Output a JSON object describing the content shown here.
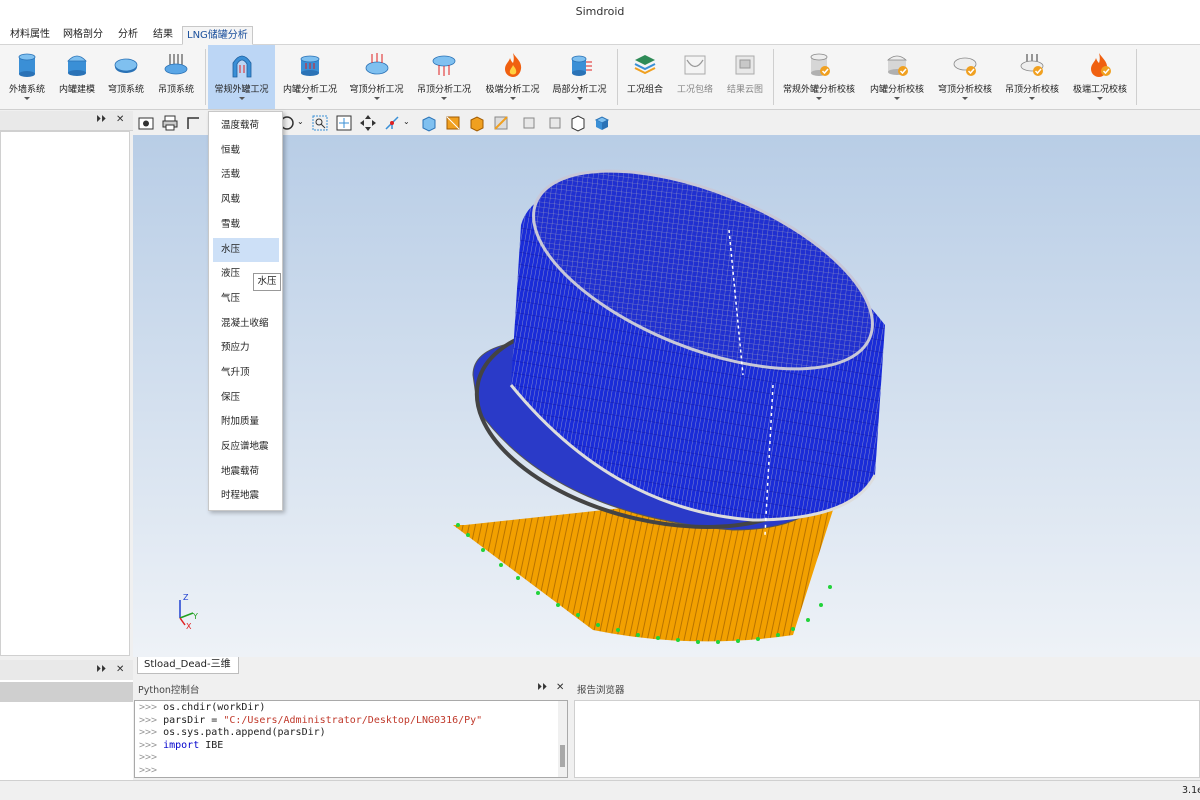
{
  "app": {
    "title": "Simdroid"
  },
  "tabs": [
    {
      "label": "材料属性"
    },
    {
      "label": "网格剖分"
    },
    {
      "label": "分析"
    },
    {
      "label": "结果"
    },
    {
      "label": "LNG储罐分析"
    }
  ],
  "ribbon": {
    "items": [
      {
        "label": "外墙系统"
      },
      {
        "label": "内罐建模"
      },
      {
        "label": "穹顶系统"
      },
      {
        "label": "吊顶系统"
      },
      {
        "label": "常规外罐工况"
      },
      {
        "label": "内罐分析工况"
      },
      {
        "label": "穹顶分析工况"
      },
      {
        "label": "吊顶分析工况"
      },
      {
        "label": "极端分析工况"
      },
      {
        "label": "局部分析工况"
      },
      {
        "label": "工况组合"
      },
      {
        "label": "工况包络"
      },
      {
        "label": "结果云图"
      },
      {
        "label": "常规外罐分析校核"
      },
      {
        "label": "内罐分析校核"
      },
      {
        "label": "穹顶分析校核"
      },
      {
        "label": "吊顶分析校核"
      },
      {
        "label": "极端工况校核"
      }
    ]
  },
  "dropdown": {
    "items": [
      {
        "label": "温度载荷"
      },
      {
        "label": "恒载"
      },
      {
        "label": "活载"
      },
      {
        "label": "风载"
      },
      {
        "label": "雪载"
      },
      {
        "label": "水压"
      },
      {
        "label": "液压"
      },
      {
        "label": "气压"
      },
      {
        "label": "混凝土收缩"
      },
      {
        "label": "预应力"
      },
      {
        "label": "气升顶"
      },
      {
        "label": "保压"
      },
      {
        "label": "附加质量"
      },
      {
        "label": " 反应谱地震"
      },
      {
        "label": "地震载荷"
      },
      {
        "label": "时程地震"
      }
    ],
    "hovered": "水压",
    "tooltip": "水压"
  },
  "viewport": {
    "tab_label": "Stload_Dead-三维",
    "axis": {
      "x": "X",
      "y": "Y",
      "z": "Z"
    },
    "colors": {
      "mesh_blue": "#0a1cd8",
      "piles_orange": "#f5a000",
      "pile_ends_green": "#22d33a"
    }
  },
  "python_console": {
    "title": "Python控制台",
    "lines": [
      {
        "prompt": ">>> ",
        "code": "os.chdir(workDir)"
      },
      {
        "prompt": ">>> ",
        "pre": "parsDir = ",
        "str": "\"C:/Users/Administrator/Desktop/LNG0316/Py\""
      },
      {
        "prompt": ">>> ",
        "code": "os.sys.path.append(parsDir)"
      },
      {
        "prompt": ">>> ",
        "kw": "import",
        "code": " IBE"
      },
      {
        "prompt": ">>> "
      },
      {
        "prompt": ">>> "
      }
    ]
  },
  "report_browser": {
    "title": "报告浏览器"
  },
  "statusbar": {
    "text": "3.1e"
  }
}
